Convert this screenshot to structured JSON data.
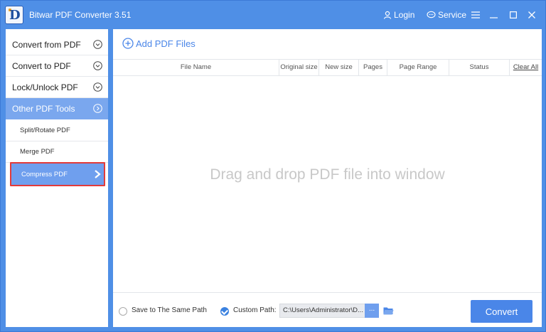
{
  "window": {
    "title": "Bitwar PDF Converter 3.51",
    "logo_letter": "D"
  },
  "titlebar": {
    "login": "Login",
    "service": "Service"
  },
  "sidebar": {
    "items": [
      {
        "label": "Convert from PDF"
      },
      {
        "label": "Convert to PDF"
      },
      {
        "label": "Lock/Unlock PDF"
      },
      {
        "label": "Other PDF Tools"
      }
    ],
    "subitems": [
      {
        "label": "Split/Rotate PDF"
      },
      {
        "label": "Merge PDF"
      },
      {
        "label": "Compress PDF"
      }
    ]
  },
  "main": {
    "add_files": "Add PDF Files",
    "columns": [
      "File Name",
      "Original size",
      "New size",
      "Pages",
      "Page Range",
      "Status"
    ],
    "clear_all": "Clear All",
    "empty_message": "Drag and drop PDF file into window"
  },
  "bottom": {
    "same_path_label": "Save to The Same Path",
    "custom_path_label": "Custom Path:",
    "custom_path_value": "C:\\Users\\Administrator\\D...",
    "browse_label": "...",
    "convert_label": "Convert"
  },
  "colors": {
    "accent": "#4a86e8",
    "selected_border": "#e23b3b",
    "titlebar": "#4f8fe6"
  }
}
